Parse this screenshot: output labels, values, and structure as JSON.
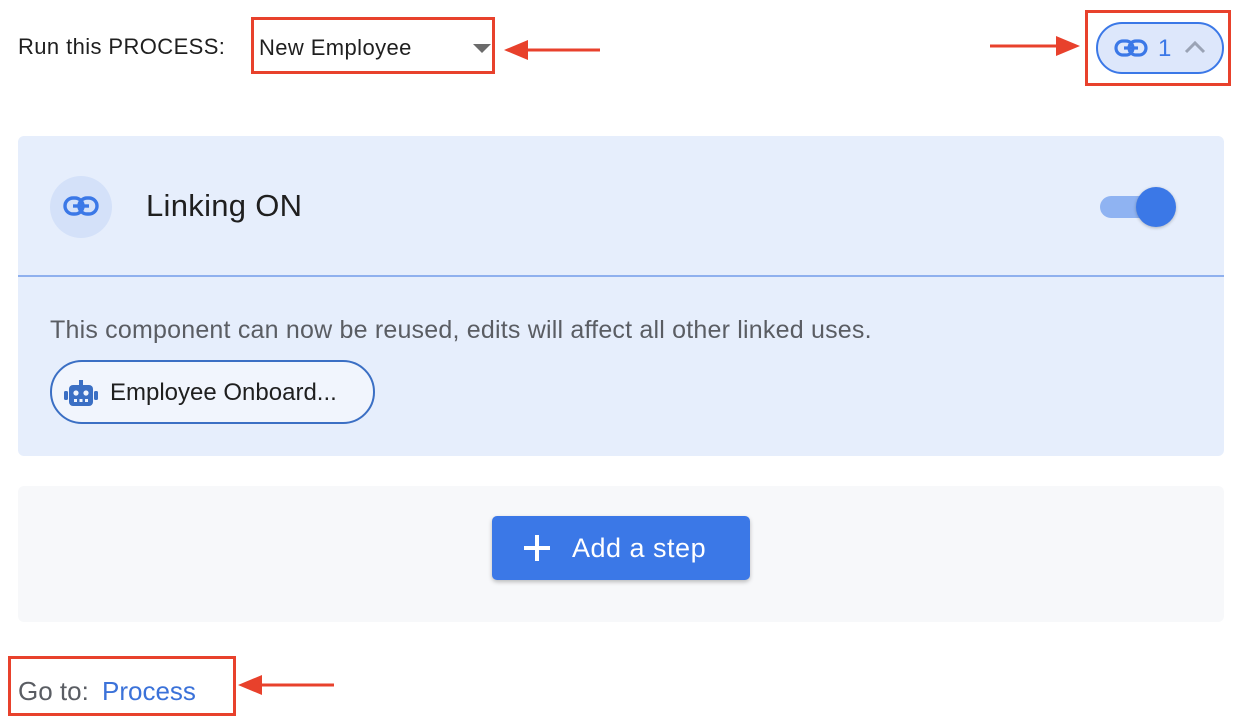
{
  "header": {
    "run_label": "Run this PROCESS:",
    "process_select": {
      "value": "New Employee"
    },
    "link_count": "1"
  },
  "linking_card": {
    "title": "Linking ON",
    "toggle_on": true,
    "description": "This component can now be reused, edits will affect all other linked uses.",
    "chip_label": "Employee Onboard..."
  },
  "steps": {
    "add_step_label": "Add a step"
  },
  "footer": {
    "goto_prefix": "Go to:",
    "goto_link": "Process"
  },
  "icons": {
    "link": "link-icon",
    "caret": "caret-down-icon",
    "chevron": "chevron-up-icon",
    "robot": "robot-icon",
    "plus": "plus-icon",
    "annotation_arrow": "arrow-icon"
  },
  "colors": {
    "accent": "#3b78e7",
    "card_bg": "#e6eefc",
    "annotation": "#e8412c",
    "link_text": "#3b72d9"
  }
}
